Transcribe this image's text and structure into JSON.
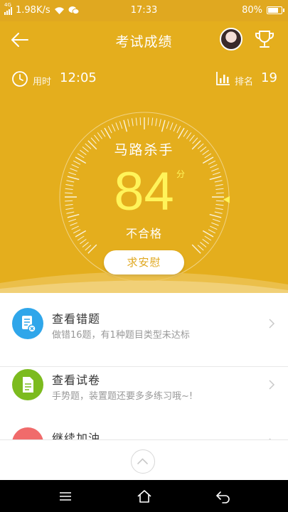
{
  "status_bar": {
    "network": "1.98K/s",
    "time": "17:33",
    "battery": "80%",
    "battery_level": 0.8,
    "signal_label": "4G"
  },
  "header": {
    "title": "考试成绩"
  },
  "stats": {
    "time_label": "用时",
    "time_value": "12:05",
    "rank_label": "排名",
    "rank_value": "19"
  },
  "result": {
    "nickname": "马路杀手",
    "score": "84",
    "score_unit": "分",
    "verdict": "不合格",
    "comfort_button": "求安慰",
    "score_max": 100
  },
  "menu": [
    {
      "title": "查看错题",
      "subtitle": "做错16题，有1种题目类型未达标",
      "icon": "wrong-answers-icon",
      "color": "#2fa6ea"
    },
    {
      "title": "查看试卷",
      "subtitle": "手势题，装置题还要多多练习哦~!",
      "icon": "paper-icon",
      "color": "#7cbb1e"
    },
    {
      "title": "继续加油",
      "subtitle": "",
      "icon": "gift-icon",
      "color": "#f06b6b"
    }
  ],
  "colors": {
    "theme": "#e4ae1d",
    "score": "#fff45a"
  }
}
